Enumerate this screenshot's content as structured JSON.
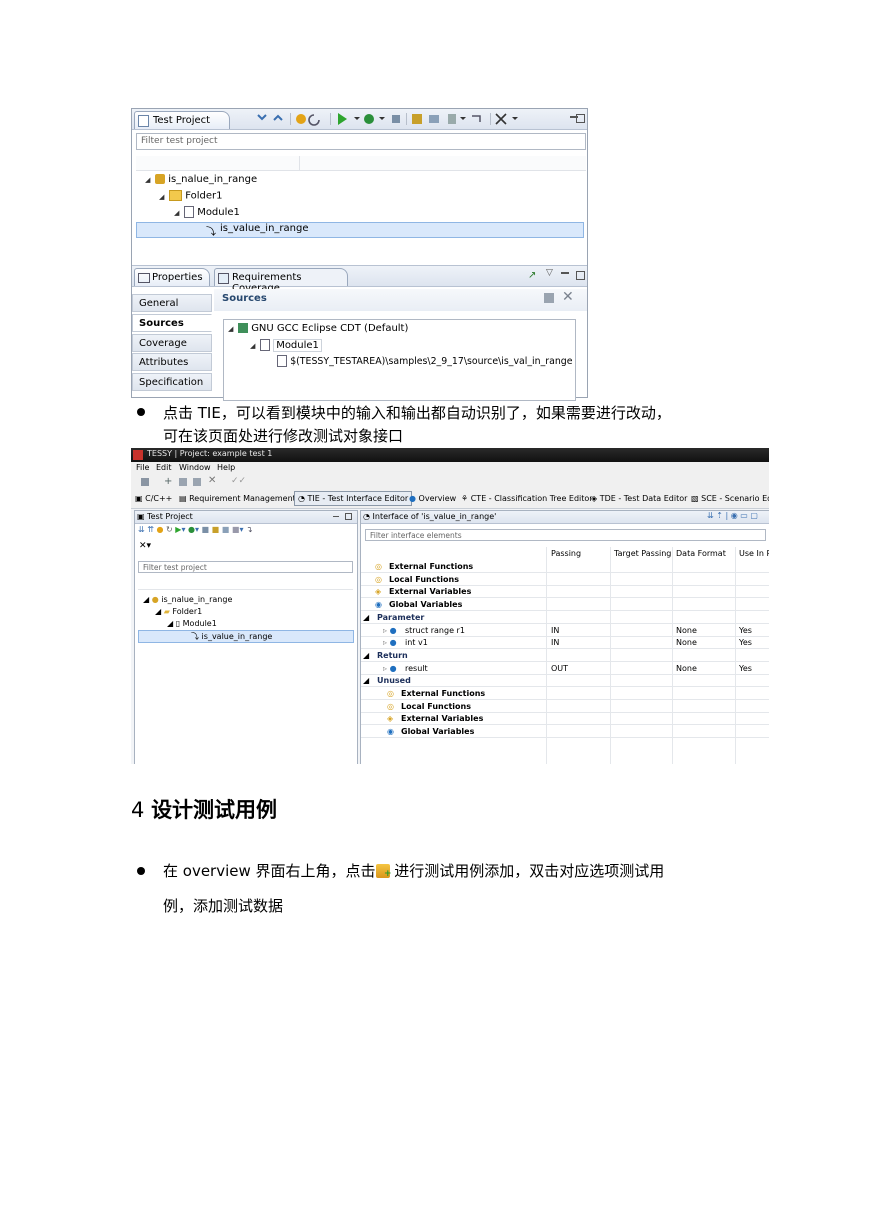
{
  "shot1": {
    "test_project_tab": "Test Project",
    "filter_placeholder": "Filter test project",
    "tree": [
      "is_nalue_in_range",
      "Folder1",
      "Module1",
      "is_value_in_range"
    ],
    "properties_tab": "Properties",
    "requirements_tab": "Requirements Coverage",
    "side_tabs": [
      "General",
      "Sources",
      "Coverage",
      "Attributes",
      "Specification"
    ],
    "sources_header": "Sources",
    "sources_tree": [
      "GNU GCC Eclipse CDT (Default)",
      "Module1",
      "$(TESSY_TESTAREA)\\samples\\2_9_17\\source\\is_val_in_range"
    ]
  },
  "para1": {
    "line1": "点击 TIE，可以看到模块中的输入和输出都自动识别了，如果需要进行改动，",
    "line2": "可在该页面处进行修改测试对象接口"
  },
  "shot2": {
    "window_title": "TESSY | Project: example test 1",
    "menu": [
      "File",
      "Edit",
      "Window",
      "Help"
    ],
    "perspectives": [
      "C/C++",
      "Requirement Management",
      "TIE - Test Interface Editor",
      "Overview",
      "CTE - Classification Tree Editor",
      "TDE - Test Data Editor",
      "SCE - Scenario Ed"
    ],
    "left_tab": "Test Project",
    "filter_placeholder": "Filter test project",
    "tree": [
      "is_nalue_in_range",
      "Folder1",
      "Module1",
      "is_value_in_range"
    ],
    "right_tab": "Interface of 'is_value_in_range'",
    "interface_filter": "Filter interface elements",
    "columns": [
      "Passing",
      "Target Passing",
      "Data Format",
      "Use In R"
    ],
    "rows": [
      {
        "label": "External Functions",
        "passing": "",
        "format": "",
        "use": ""
      },
      {
        "label": "Local Functions",
        "passing": "",
        "format": "",
        "use": ""
      },
      {
        "label": "External Variables",
        "passing": "",
        "format": "",
        "use": ""
      },
      {
        "label": "Global Variables",
        "passing": "",
        "format": "",
        "use": ""
      },
      {
        "label": "Parameter",
        "passing": "",
        "format": "",
        "use": ""
      },
      {
        "label": "struct range r1",
        "passing": "IN",
        "format": "None",
        "use": "Yes"
      },
      {
        "label": "int v1",
        "passing": "IN",
        "format": "None",
        "use": "Yes"
      },
      {
        "label": "Return",
        "passing": "",
        "format": "",
        "use": ""
      },
      {
        "label": "result",
        "passing": "OUT",
        "format": "None",
        "use": "Yes"
      },
      {
        "label": "Unused",
        "passing": "",
        "format": "",
        "use": ""
      },
      {
        "label": "External Functions",
        "passing": "",
        "format": "",
        "use": ""
      },
      {
        "label": "Local Functions",
        "passing": "",
        "format": "",
        "use": ""
      },
      {
        "label": "External Variables",
        "passing": "",
        "format": "",
        "use": ""
      },
      {
        "label": "Global Variables",
        "passing": "",
        "format": "",
        "use": ""
      }
    ]
  },
  "heading": {
    "number": "4",
    "title": "设计测试用例"
  },
  "para2": {
    "part1": "在 overview 界面右上角，点击",
    "part2": " 进行测试用例添加，双击对应选项测试用",
    "line2": "例，添加测试数据"
  }
}
